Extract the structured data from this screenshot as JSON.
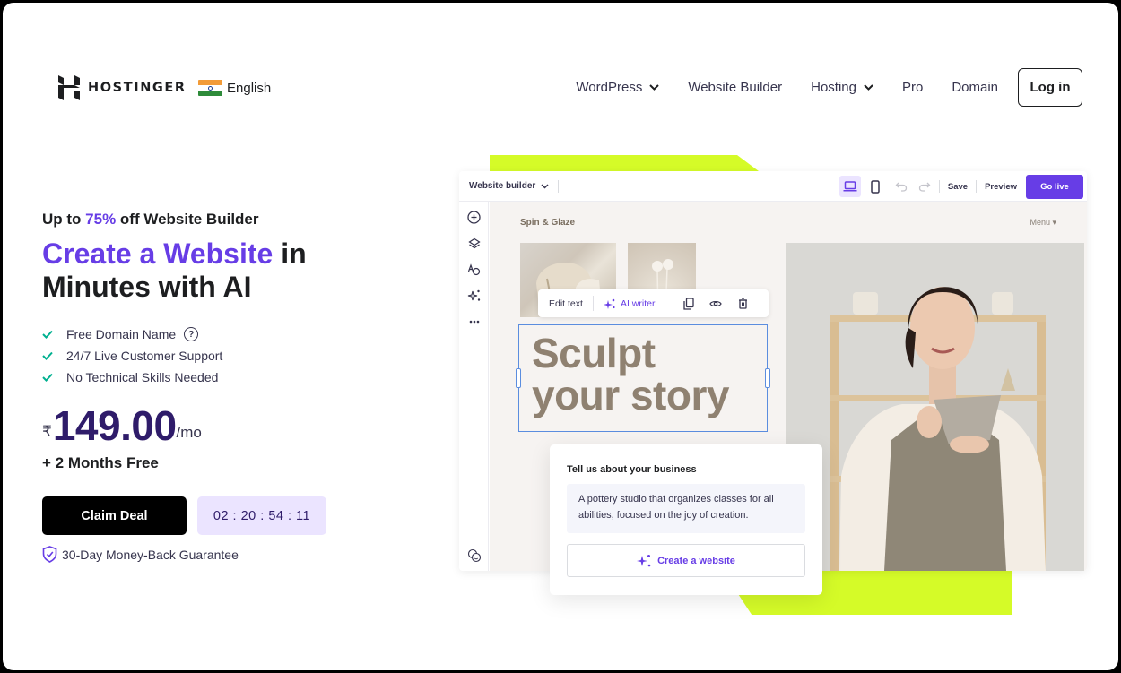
{
  "header": {
    "brand": "HOSTINGER",
    "language": "English",
    "nav": [
      {
        "label": "WordPress",
        "has_dropdown": true
      },
      {
        "label": "Website Builder",
        "has_dropdown": false
      },
      {
        "label": "Hosting",
        "has_dropdown": true
      },
      {
        "label": "Pro",
        "has_dropdown": false
      },
      {
        "label": "Domain",
        "has_dropdown": false
      }
    ],
    "login_label": "Log in"
  },
  "hero": {
    "promo_prefix": "Up to ",
    "promo_accent": "75%",
    "promo_suffix": " off Website Builder",
    "headline_accent": "Create a Website",
    "headline_rest_1": " in",
    "headline_rest_2": "Minutes with AI",
    "features": [
      "Free Domain Name",
      "24/7 Live Customer Support",
      "No Technical Skills Needed"
    ],
    "currency": "₹",
    "price": "149.00",
    "period": "/mo",
    "bonus": "+ 2 Months Free",
    "cta_label": "Claim Deal",
    "countdown": "02 : 20 : 54 : 11",
    "guarantee": "30-Day Money-Back Guarantee"
  },
  "builder": {
    "title": "Website builder",
    "save_label": "Save",
    "preview_label": "Preview",
    "golive_label": "Go live",
    "site_name": "Spin & Glaze",
    "site_menu": "Menu ▾",
    "toolbar": {
      "edit_text": "Edit text",
      "ai_writer": "AI writer"
    },
    "hero_line_1": "Sculpt",
    "hero_line_2": "your story"
  },
  "ai_card": {
    "label": "Tell us about your business",
    "textarea_value": "A pottery studio that organizes classes for all abilities, focused on the joy of creation.",
    "button_label": "Create a website"
  },
  "colors": {
    "accent": "#673de6",
    "lime": "#d5fb28",
    "dark_navy": "#2f1c6a",
    "check_green": "#00b090"
  }
}
